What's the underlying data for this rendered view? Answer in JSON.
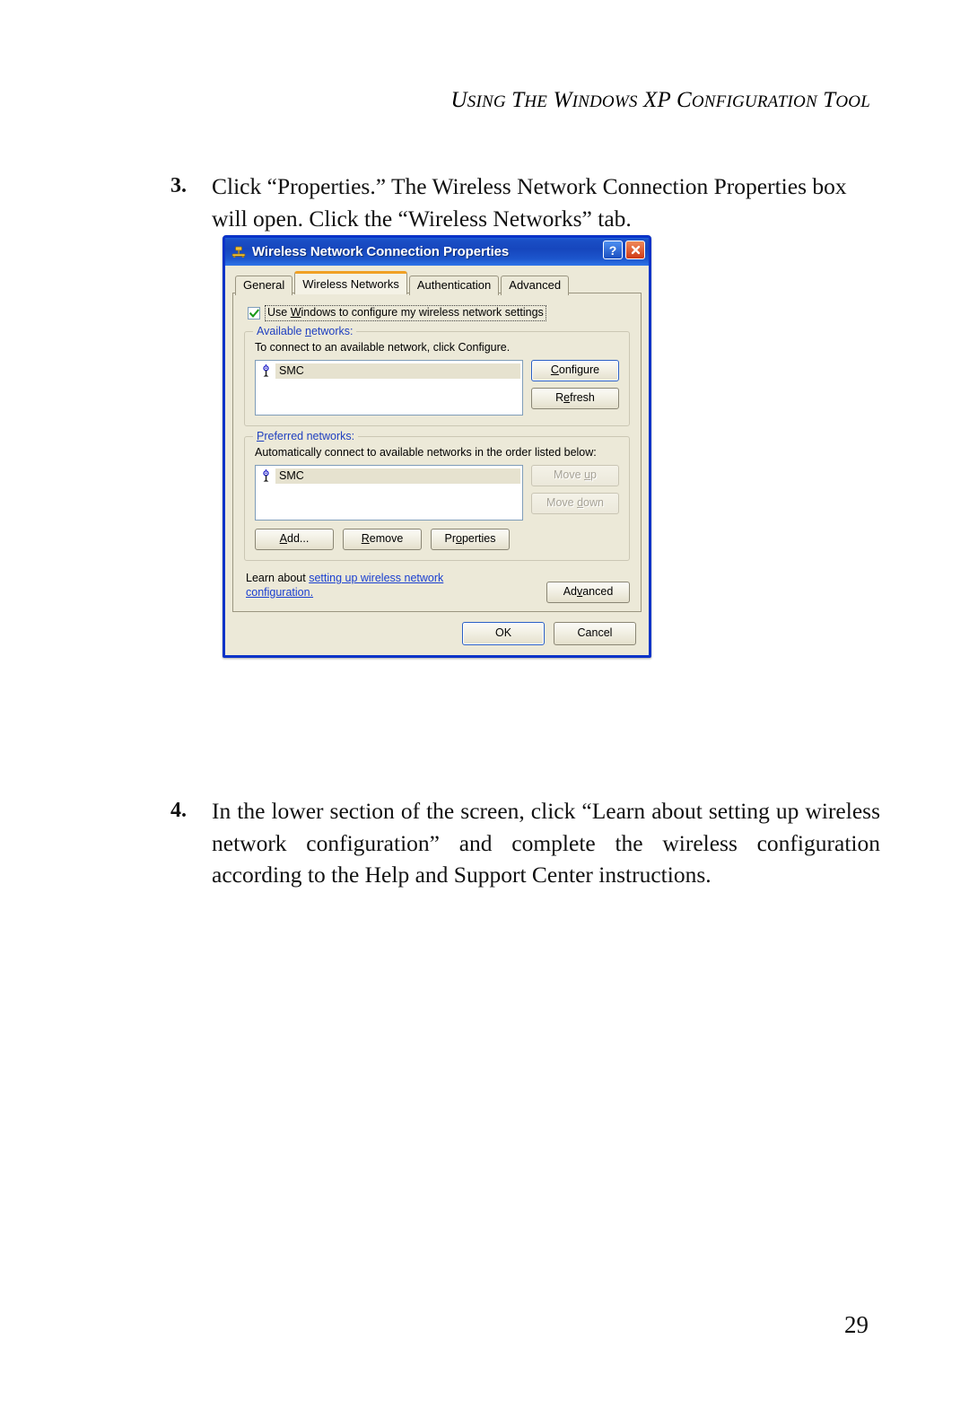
{
  "page": {
    "running_header": "Using the Windows XP Configuration Tool",
    "header_parts": {
      "w1_cap": "U",
      "w1_rest": "SING",
      "w2_cap": "T",
      "w2_rest": "HE",
      "w3_cap": "W",
      "w3_rest": "INDOWS",
      "w4": "XP",
      "w5_cap": "C",
      "w5_rest": "ONFIGURATION",
      "w6_cap": "T",
      "w6_rest": "OOL"
    },
    "number": "29"
  },
  "steps": [
    {
      "number": "3.",
      "text": "Click “Properties.” The Wireless Network Connection Properties box will open.  Click the “Wireless Networks” tab."
    },
    {
      "number": "4.",
      "text": "In the lower section of the screen, click “Learn about setting up wireless network configuration” and complete the wireless configuration according to the Help and Support Center instructions."
    }
  ],
  "dialog": {
    "title": "Wireless Network Connection Properties",
    "title_icon": "network-connection-icon",
    "help_button": "?",
    "close_button": "close-icon",
    "tabs": [
      {
        "label": "General",
        "active": false
      },
      {
        "label": "Wireless Networks",
        "active": true
      },
      {
        "label": "Authentication",
        "active": false
      },
      {
        "label": "Advanced",
        "active": false
      }
    ],
    "use_windows_checkbox": {
      "checked": true,
      "label_prefix": "Use ",
      "label_accel": "W",
      "label_suffix": "indows to configure my wireless network settings"
    },
    "available_networks": {
      "legend_prefix": "Available ",
      "legend_accel": "n",
      "legend_suffix": "etworks:",
      "description": "To connect to an available network, click Configure.",
      "items": [
        {
          "name": "SMC",
          "icon": "wireless-network-icon",
          "selected": true
        }
      ],
      "buttons": [
        {
          "accel": "C",
          "rest": "onfigure",
          "disabled": false,
          "focus": true
        },
        {
          "prefix": "R",
          "accel": "e",
          "rest": "fresh",
          "disabled": false,
          "focus": false
        }
      ]
    },
    "preferred_networks": {
      "legend_accel": "P",
      "legend_suffix": "referred networks:",
      "description": "Automatically connect to available networks in the order listed below:",
      "items": [
        {
          "name": "SMC",
          "icon": "wireless-network-icon",
          "selected": true
        }
      ],
      "move_buttons": [
        {
          "prefix": "Move ",
          "accel": "u",
          "rest": "p",
          "disabled": true
        },
        {
          "prefix": "Move ",
          "accel": "d",
          "rest": "own",
          "disabled": true
        }
      ],
      "action_buttons": [
        {
          "accel": "A",
          "rest": "dd...",
          "disabled": false
        },
        {
          "accel": "R",
          "rest": "emove",
          "disabled": false
        },
        {
          "prefix": "Pr",
          "accel": "o",
          "rest": "perties",
          "disabled": false
        }
      ]
    },
    "learn_about": {
      "prefix": "Learn about ",
      "link": "setting up wireless network configuration."
    },
    "advanced_button": {
      "prefix": "Ad",
      "accel": "v",
      "rest": "anced"
    },
    "footer_buttons": [
      {
        "label": "OK",
        "default": true
      },
      {
        "label": "Cancel",
        "default": false
      }
    ]
  },
  "colors": {
    "titlebar_blue": "#1646bd",
    "dialog_face": "#ece9d8",
    "active_tab_accent": "#f0a024",
    "link_blue": "#1a3fd0",
    "group_legend_blue": "#2040c0",
    "close_red": "#cf3a16",
    "selection_beige": "#e6e2cf",
    "checkmark_green": "#1a9a1a"
  }
}
